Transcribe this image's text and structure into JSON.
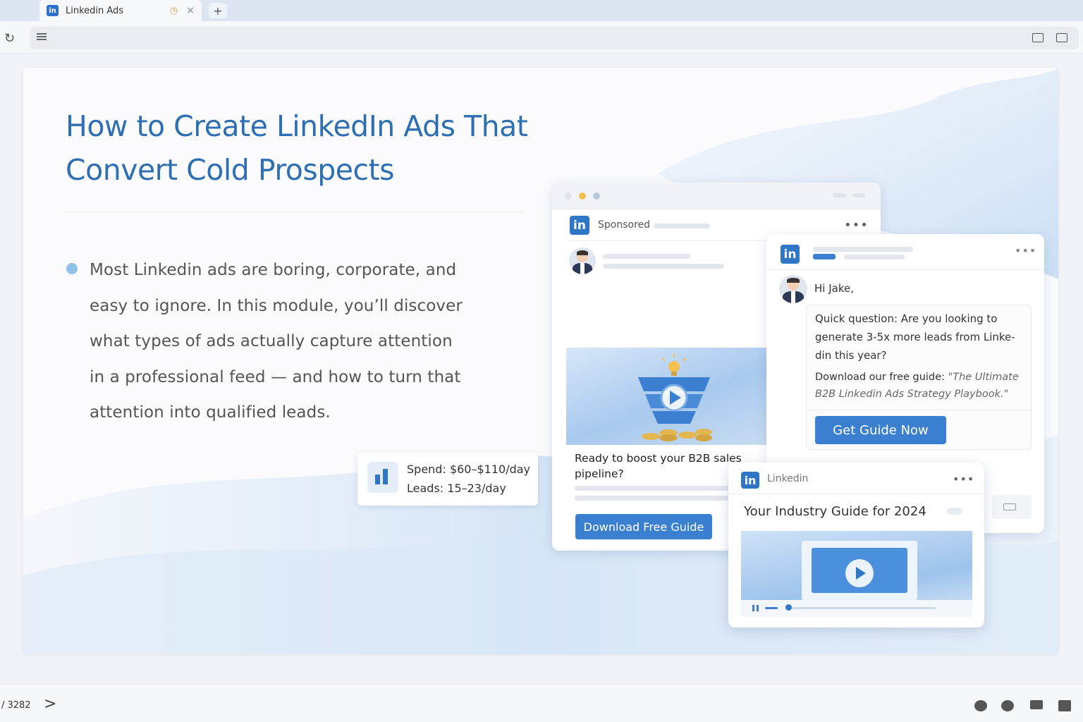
{
  "browser": {
    "tab_title": "Linkedin Ads",
    "tab_favicon_text": "in",
    "new_tab_label": "+",
    "close_label": "×",
    "timer_glyph": "◷",
    "reload_glyph": "↻"
  },
  "slide": {
    "title": "How to Create LinkedIn Ads That Convert Cold Prospects",
    "bullet": "Most Linkedin ads are boring, corporate, and easy to ignore. In this module, you’ll discover what types of ads actually capture attention in a professional feed — and how to turn that attention into qualified leads.",
    "stats": {
      "spend_label": "Spend:",
      "spend_value": "$60–$110/day",
      "leads_label": "Leads:",
      "leads_value": "15–23/day"
    }
  },
  "sponsored_card": {
    "logo": "in",
    "label": "Sponsored",
    "more": "•••",
    "ad_text": "Ready to boost your B2B sales pipeline?",
    "cta": "Download Free Guide"
  },
  "message_card": {
    "logo": "in",
    "more": "•••",
    "greeting": "Hi Jake,",
    "question": "Quick question: Are you looking to generate 3-5x more leads from Linke-din this year?",
    "offer_prefix": "Download our free guide: ",
    "offer_title": "\"The Ultimate B2B Linkedin Ads Strategy Playbook.\"",
    "cta": "Get Guide Now"
  },
  "guide_card": {
    "logo": "in",
    "brand": "Linkedin",
    "more": "•••",
    "title": "Your Industry Guide for 2024"
  },
  "footer": {
    "page_count": "/ 3282",
    "next_glyph": ">"
  },
  "colors": {
    "accent": "#2f77c6",
    "title": "#2e6fb4",
    "button": "#3a7fd0"
  }
}
